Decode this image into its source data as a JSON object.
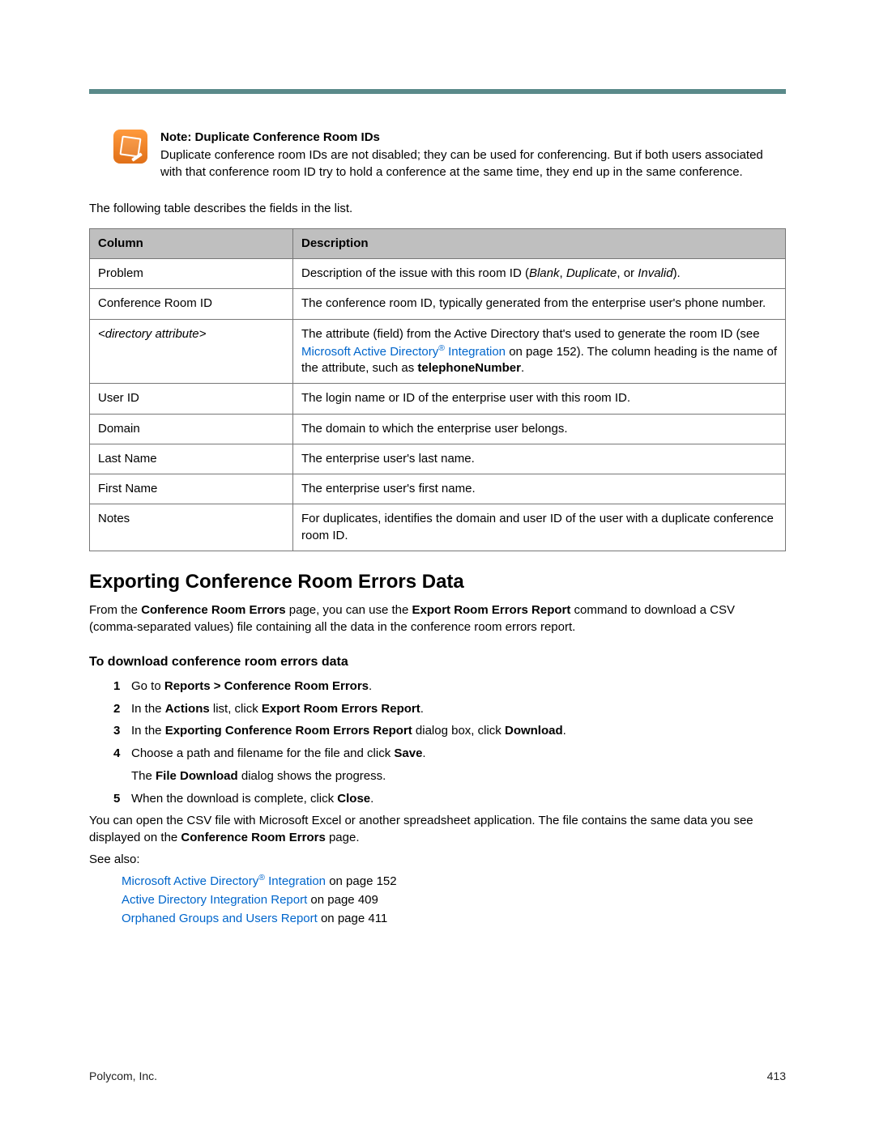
{
  "note": {
    "title": "Note: Duplicate Conference Room IDs",
    "body": "Duplicate conference room IDs are not disabled; they can be used for conferencing. But if both users associated with that conference room ID try to hold a conference at the same time, they end up in the same conference."
  },
  "intro": "The following table describes the fields in the list.",
  "table": {
    "headers": {
      "col": "Column",
      "desc": "Description"
    },
    "rows": [
      {
        "col": "Problem",
        "desc_pre": "Description of the issue with this room ID (",
        "i1": "Blank",
        "sep1": ", ",
        "i2": "Duplicate",
        "sep2": ", or ",
        "i3": "Invalid",
        "desc_post": ")."
      },
      {
        "col": "Conference Room ID",
        "desc": "The conference room ID, typically generated from the enterprise user's phone number."
      },
      {
        "col": "<directory attribute>",
        "desc_pre": "The attribute (field) from the Active Directory that's used to generate the room ID (see ",
        "link": "Microsoft Active Directory",
        "reg": "®",
        "link2": " Integration",
        "mid": " on page 152). The column heading is the name of the attribute, such as ",
        "bold": "telephoneNumber",
        "post": "."
      },
      {
        "col": "User ID",
        "desc": "The login name or ID of the enterprise user with this room ID."
      },
      {
        "col": "Domain",
        "desc": "The domain to which the enterprise user belongs."
      },
      {
        "col": "Last Name",
        "desc": "The enterprise user's last name."
      },
      {
        "col": "First Name",
        "desc": "The enterprise user's first name."
      },
      {
        "col": "Notes",
        "desc": "For duplicates, identifies the domain and user ID of the user with a duplicate conference room ID."
      }
    ]
  },
  "section": {
    "heading": "Exporting Conference Room Errors Data",
    "p1_pre": "From the ",
    "p1_b1": "Conference Room Errors",
    "p1_mid": " page, you can use the ",
    "p1_b2": "Export Room Errors Report",
    "p1_post": " command to download a CSV (comma-separated values) file containing all the data in the conference room errors report.",
    "sub": "To download conference room errors data",
    "steps": [
      {
        "n": "1",
        "pre": "Go to ",
        "b": "Reports > Conference Room Errors",
        "post": "."
      },
      {
        "n": "2",
        "pre": "In the ",
        "b": "Actions",
        "mid": " list, click ",
        "b2": "Export Room Errors Report",
        "post": "."
      },
      {
        "n": "3",
        "pre": "In the ",
        "b": "Exporting Conference Room Errors Report",
        "mid": " dialog box, click ",
        "b2": "Download",
        "post": "."
      },
      {
        "n": "4",
        "pre": "Choose a path and filename for the file and click ",
        "b": "Save",
        "post": ".",
        "extra_pre": "The ",
        "extra_b": "File Download",
        "extra_post": " dialog shows the progress."
      },
      {
        "n": "5",
        "pre": "When the download is complete, click ",
        "b": "Close",
        "post": "."
      }
    ],
    "p2_pre": "You can open the CSV file with Microsoft Excel or another spreadsheet application. The file contains the same data you see displayed on the ",
    "p2_b": "Conference Room Errors",
    "p2_post": " page.",
    "see_also": "See also:",
    "links": [
      {
        "text": "Microsoft Active Directory",
        "reg": "®",
        "text2": " Integration",
        "suffix": " on page 152"
      },
      {
        "text": "Active Directory Integration Report",
        "suffix": " on page 409"
      },
      {
        "text": "Orphaned Groups and Users Report",
        "suffix": " on page 411"
      }
    ]
  },
  "footer": {
    "left": "Polycom, Inc.",
    "right": "413"
  }
}
